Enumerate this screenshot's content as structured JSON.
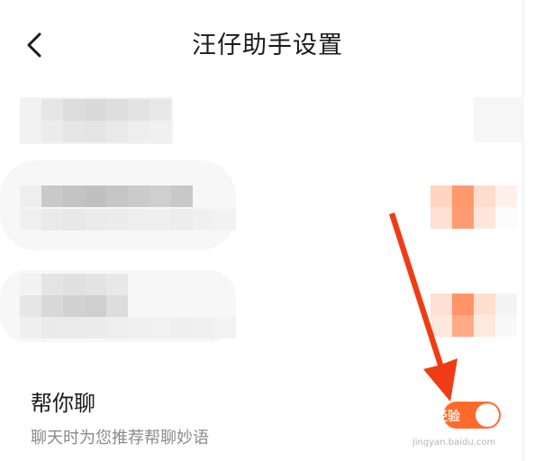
{
  "header": {
    "title": "汪仔助手设置"
  },
  "setting": {
    "title": "帮你聊",
    "description": "聊天时为您推荐帮聊妙语",
    "enabled": true
  },
  "watermark": {
    "brand": "du 经验",
    "url": "jingyan.baidu.com"
  },
  "colors": {
    "accent": "#ff6a2c",
    "arrow": "#f03c14"
  }
}
